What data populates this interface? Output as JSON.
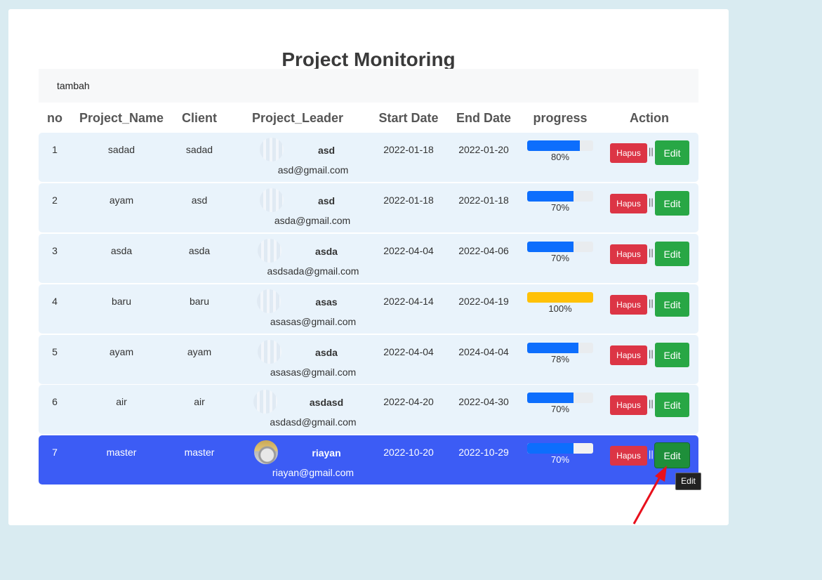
{
  "page": {
    "title": "Project Monitoring",
    "add_link": "tambah"
  },
  "table": {
    "headers": [
      "no",
      "Project_Name",
      "Client",
      "Project_Leader",
      "Start Date",
      "End Date",
      "progress",
      "Action"
    ],
    "delete_label": "Hapus",
    "separator": "||",
    "edit_label": "Edit",
    "rows": [
      {
        "no": "1",
        "project": "sadad",
        "client": "sadad",
        "leader": "asd",
        "email": "asd@gmail.com",
        "start": "2022-01-18",
        "end": "2022-01-20",
        "progress": 80,
        "progress_label": "80%"
      },
      {
        "no": "2",
        "project": "ayam",
        "client": "asd",
        "leader": "asd",
        "email": "asda@gmail.com",
        "start": "2022-01-18",
        "end": "2022-01-18",
        "progress": 70,
        "progress_label": "70%"
      },
      {
        "no": "3",
        "project": "asda",
        "client": "asda",
        "leader": "asda",
        "email": "asdsada@gmail.com",
        "start": "2022-04-04",
        "end": "2022-04-06",
        "progress": 70,
        "progress_label": "70%"
      },
      {
        "no": "4",
        "project": "baru",
        "client": "baru",
        "leader": "asas",
        "email": "asasas@gmail.com",
        "start": "2022-04-14",
        "end": "2022-04-19",
        "progress": 100,
        "progress_label": "100%"
      },
      {
        "no": "5",
        "project": "ayam",
        "client": "ayam",
        "leader": "asda",
        "email": "asasas@gmail.com",
        "start": "2022-04-04",
        "end": "2024-04-04",
        "progress": 78,
        "progress_label": "78%"
      },
      {
        "no": "6",
        "project": "air",
        "client": "air",
        "leader": "asdasd",
        "email": "asdasd@gmail.com",
        "start": "2022-04-20",
        "end": "2022-04-30",
        "progress": 70,
        "progress_label": "70%"
      },
      {
        "no": "7",
        "project": "master",
        "client": "master",
        "leader": "riayan",
        "email": "riayan@gmail.com",
        "start": "2022-10-20",
        "end": "2022-10-29",
        "progress": 70,
        "progress_label": "70%"
      }
    ]
  },
  "tooltip": "Edit",
  "colors": {
    "background": "#d9ebf1",
    "row": "#e9f3fb",
    "selected_row": "#3c5cf5",
    "delete": "#dc3545",
    "edit": "#28a745",
    "progress": "#0d6efd",
    "progress_complete": "#ffc107",
    "annotation_arrow": "#e8101c"
  },
  "icons": {
    "avatar": "avatar-icon",
    "arrow": "arrow-icon"
  }
}
